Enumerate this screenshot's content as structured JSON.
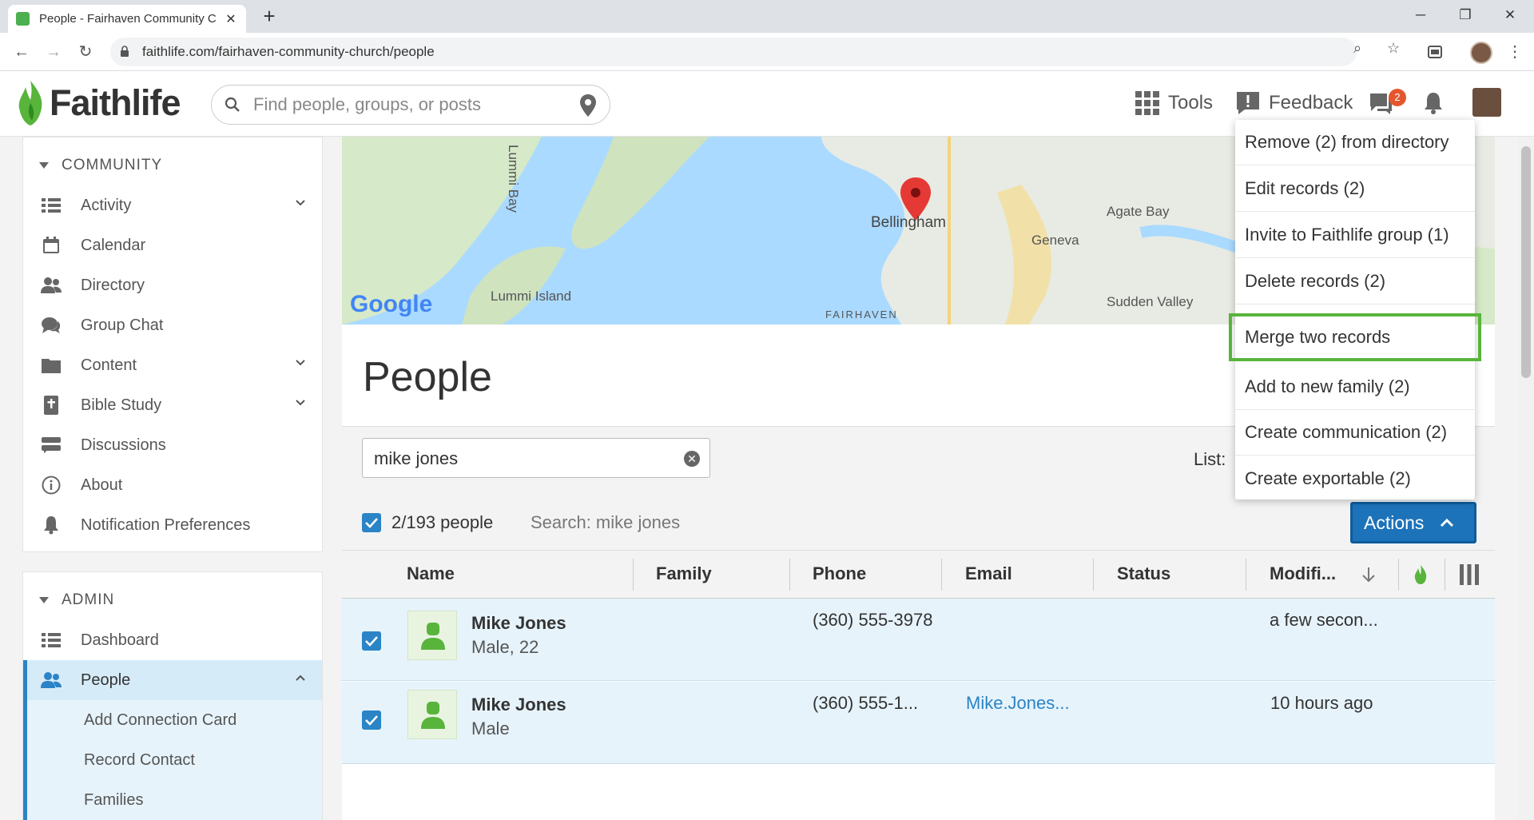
{
  "browser": {
    "tab_title": "People - Fairhaven Community C",
    "url": "faithlife.com/fairhaven-community-church/people"
  },
  "header": {
    "logo_text": "Faithlife",
    "search_placeholder": "Find people, groups, or posts",
    "tools_label": "Tools",
    "feedback_label": "Feedback",
    "messages_badge": "2"
  },
  "sidebar": {
    "community_heading": "COMMUNITY",
    "community_items": [
      {
        "label": "Activity",
        "icon": "activity-icon",
        "expandable": true
      },
      {
        "label": "Calendar",
        "icon": "calendar-icon",
        "expandable": false
      },
      {
        "label": "Directory",
        "icon": "directory-icon",
        "expandable": false
      },
      {
        "label": "Group Chat",
        "icon": "chat-icon",
        "expandable": false
      },
      {
        "label": "Content",
        "icon": "folder-icon",
        "expandable": true
      },
      {
        "label": "Bible Study",
        "icon": "bible-icon",
        "expandable": true
      },
      {
        "label": "Discussions",
        "icon": "discussions-icon",
        "expandable": false
      },
      {
        "label": "About",
        "icon": "info-icon",
        "expandable": false
      },
      {
        "label": "Notification Preferences",
        "icon": "bell-icon",
        "expandable": false
      }
    ],
    "admin_heading": "ADMIN",
    "admin_items": [
      {
        "label": "Dashboard",
        "icon": "dashboard-icon"
      },
      {
        "label": "People",
        "icon": "people-icon",
        "active": true
      }
    ],
    "people_subitems": [
      "Add Connection Card",
      "Record Contact",
      "Families"
    ]
  },
  "map": {
    "labels": [
      "Lummi Bay",
      "Bellingham",
      "Agate Bay",
      "Geneva",
      "Lummi Island",
      "Sudden Valley",
      "FAIRHAVEN",
      "Google"
    ]
  },
  "main": {
    "title": "People",
    "filter_value": "mike jones",
    "list_label": "List:",
    "selection_count": "2/193 people",
    "search_note": "Search: mike jones",
    "actions_label": "Actions",
    "columns": [
      "Name",
      "Family",
      "Phone",
      "Email",
      "Status",
      "Modifi..."
    ],
    "rows": [
      {
        "name": "Mike Jones",
        "sub": "Male, 22",
        "phone": "(360) 555-3978",
        "email": "",
        "modified": "a few secon..."
      },
      {
        "name": "Mike Jones",
        "sub": "Male",
        "phone": "(360) 555-1...",
        "email": "Mike.Jones...",
        "modified": "10 hours ago"
      }
    ]
  },
  "actions_menu": [
    "Remove (2) from directory",
    "Edit records (2)",
    "Invite to Faithlife group (1)",
    "Delete records (2)",
    "Merge two records",
    "Add to new family (2)",
    "Create communication (2)",
    "Create exportable (2)"
  ],
  "colors": {
    "accent": "#2a84c6",
    "highlight": "#58b43b",
    "brand_green": "#4caf50"
  }
}
